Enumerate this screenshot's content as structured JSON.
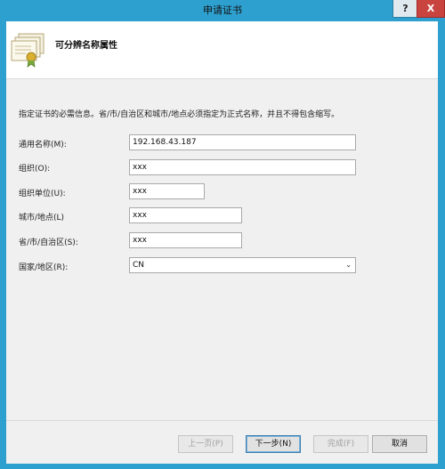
{
  "window": {
    "title": "申请证书",
    "help_label": "?",
    "close_label": "X"
  },
  "header": {
    "title": "可分辨名称属性",
    "icon": "certificate-icon"
  },
  "description": "指定证书的必需信息。省/市/自治区和城市/地点必须指定为正式名称，并且不得包含缩写。",
  "form": {
    "common_name": {
      "label": "通用名称(M):",
      "value": "192.168.43.187"
    },
    "organization": {
      "label": "组织(O):",
      "value": "xxx"
    },
    "org_unit": {
      "label": "组织单位(U):",
      "value": "xxx"
    },
    "city": {
      "label": "城市/地点(L)",
      "value": "xxx"
    },
    "state": {
      "label": "省/市/自治区(S):",
      "value": "xxx"
    },
    "country": {
      "label": "国家/地区(R):",
      "value": "CN"
    }
  },
  "buttons": {
    "prev": "上一页(P)",
    "next": "下一步(N)",
    "finish": "完成(F)",
    "cancel": "取消"
  }
}
